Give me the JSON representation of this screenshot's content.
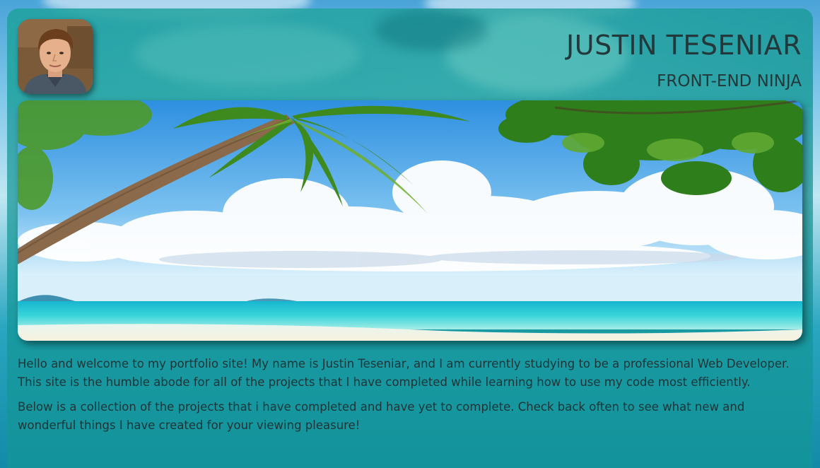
{
  "header": {
    "name": "JUSTIN TESENIAR",
    "tagline": "FRONT-END NINJA"
  },
  "avatar": {
    "icon": "profile-photo"
  },
  "hero": {
    "icon": "tropical-beach-photo"
  },
  "intro": {
    "paragraph1": "Hello and welcome to my portfolio site! My name is Justin Teseniar, and I am currently studying to be a professional Web Developer. This site is the humble abode for all of the projects that I have completed while learning how to use my code most efficiently.",
    "paragraph2": "Below is a collection of the projects that i have completed and have yet to complete. Check back often to see what new and wonderful things I have created for your viewing pleasure!"
  },
  "colors": {
    "panel": "#1e9a9a",
    "text": "#23383a",
    "sea": "#2fd0d6",
    "sky": "#3f9fe0"
  }
}
